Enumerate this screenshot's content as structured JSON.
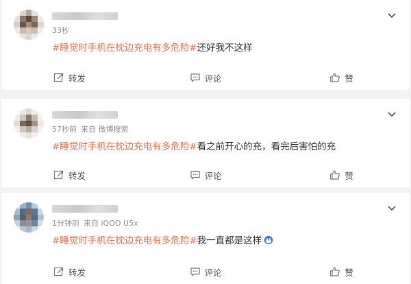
{
  "posts": [
    {
      "meta_time": "33秒",
      "meta_source": "",
      "hashtag": "#睡觉时手机在枕边充电有多危险#",
      "text": "还好我不这样",
      "avatar_colors": [
        "#f3f3f3",
        "#d9d4cf",
        "#b9a79a",
        "#e6e1dc",
        "#f5f5f5",
        "#e4e0dc",
        "#8f7767",
        "#5e4a3d",
        "#9a8576",
        "#ece9e6",
        "#d6cec6",
        "#6b5548",
        "#a78c78",
        "#7b6757",
        "#dcd6d1",
        "#ebe7e3",
        "#c9bbb0",
        "#d9c7b8",
        "#cdbdb0",
        "#f0eeec",
        "#f6f6f6",
        "#e5e1de",
        "#ded7d1",
        "#ebe8e5",
        "#f8f8f8"
      ]
    },
    {
      "meta_time": "57秒前",
      "meta_source": "来自 微博搜索",
      "hashtag": "#睡觉时手机在枕边充电有多危险#",
      "text": "看之前开心的充，看完后害怕的充",
      "avatar_colors": [
        "#f4f4f4",
        "#e9e7e5",
        "#dcd8d4",
        "#eeeeec",
        "#f6f6f6",
        "#efeeec",
        "#d2c5bb",
        "#8a7a6e",
        "#c9bdb3",
        "#f2f1f0",
        "#e3dcd6",
        "#7b695c",
        "#5f5046",
        "#a49487",
        "#ebe8e5",
        "#f0efee",
        "#cfc4ba",
        "#b8aca1",
        "#d9d1ca",
        "#f5f4f3",
        "#f7f7f7",
        "#eeedeb",
        "#e7e3df",
        "#f1f0ef",
        "#f9f9f9"
      ]
    },
    {
      "meta_time": "1分钟前",
      "meta_source": "来自 iQOO U5x",
      "hashtag": "#睡觉时手机在枕边充电有多危险#",
      "text": "我一直都是这样",
      "avatar_colors": [
        "#e3eaf0",
        "#9bb3c7",
        "#6f8fab",
        "#b9c9d6",
        "#eef2f5",
        "#a9bccd",
        "#4d6d8a",
        "#7a6e66",
        "#5c7792",
        "#cbd6df",
        "#8aa3b8",
        "#6b5d54",
        "#8c7b70",
        "#52708d",
        "#b0c1d0",
        "#c2d0db",
        "#7991a7",
        "#9f918a",
        "#6c87a0",
        "#d4dde5",
        "#e8eef3",
        "#b7c7d4",
        "#a6b8c8",
        "#c9d5df",
        "#f0f4f7"
      ]
    }
  ],
  "actions": {
    "repost": "转发",
    "comment": "评论",
    "like": "赞"
  },
  "colors": {
    "hashtag": "#eb7350",
    "page_bg": "#f2f2f2",
    "card_bg": "#ffffff"
  },
  "icons": [
    "avatar",
    "chevron-down-icon",
    "repost-icon",
    "comment-icon",
    "like-icon",
    "emoji-icon"
  ]
}
